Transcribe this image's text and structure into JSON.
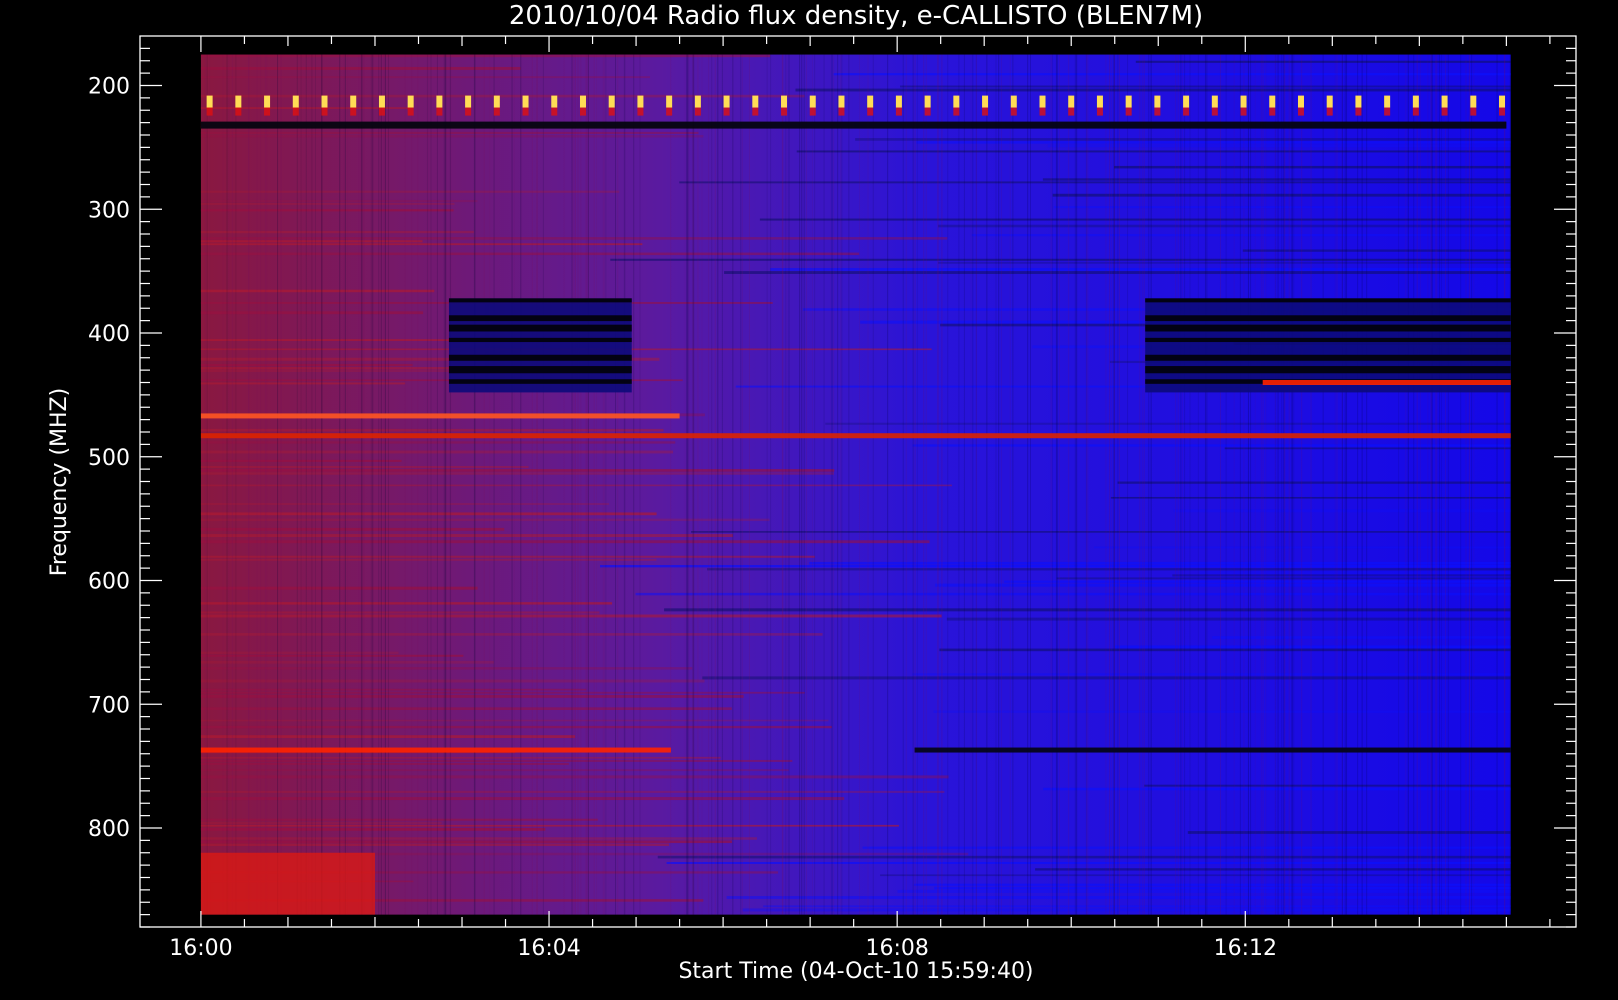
{
  "chart_data": {
    "type": "heatmap",
    "title": "2010/10/04  Radio flux density, e-CALLISTO (BLEN7M)",
    "xlabel": "Start Time (04-Oct-10 15:59:40)",
    "ylabel": "Frequency (MHZ)",
    "x_unit": "minutes after 16:00",
    "xlim": [
      -0.7,
      15.8
    ],
    "x_data_range": [
      0,
      15.05
    ],
    "x_ticks": [
      0,
      4,
      8,
      12
    ],
    "x_tick_labels": [
      "16:00",
      "16:04",
      "16:08",
      "16:12"
    ],
    "ylim": [
      880,
      160
    ],
    "y_data_range": [
      175,
      870
    ],
    "y_ticks": [
      200,
      300,
      400,
      500,
      600,
      700,
      800
    ],
    "y_tick_labels": [
      "200",
      "300",
      "400",
      "500",
      "600",
      "700",
      "800"
    ],
    "colormap": [
      "#000000",
      "#0000ff",
      "#c00000",
      "#ff0000",
      "#ffffff"
    ],
    "features": [
      {
        "kind": "periodic-pulses",
        "freq": 213,
        "x_start": 0.1,
        "x_end": 15.0,
        "period_min": 0.33,
        "color": "#ffdd55"
      },
      {
        "kind": "dark-band",
        "freq": 232,
        "x_start": 0.0,
        "x_end": 15.0,
        "color": "#050510"
      },
      {
        "kind": "dark-block",
        "freq_range": [
          372,
          448
        ],
        "x_start": 2.85,
        "x_end": 4.95
      },
      {
        "kind": "dark-block",
        "freq_range": [
          372,
          448
        ],
        "x_start": 10.85,
        "x_end": 15.05
      },
      {
        "kind": "bright-line",
        "freq": 440,
        "x_start": 12.2,
        "x_end": 15.05,
        "color": "#ff2200"
      },
      {
        "kind": "bright-line",
        "freq": 467,
        "x_start": 0.0,
        "x_end": 5.5,
        "color": "#ff5522"
      },
      {
        "kind": "bright-line",
        "freq": 483,
        "x_start": 0.0,
        "x_end": 15.05,
        "color": "#dd2200"
      },
      {
        "kind": "bright-line",
        "freq": 737,
        "x_start": 0.0,
        "x_end": 5.4,
        "color": "#ff2200"
      },
      {
        "kind": "dark-line",
        "freq": 737,
        "x_start": 8.2,
        "x_end": 15.05,
        "color": "#05051a"
      },
      {
        "kind": "red-region",
        "freq_range": [
          820,
          870
        ],
        "x_start": 0.0,
        "x_end": 2.0,
        "color": "#e01a10"
      }
    ]
  }
}
